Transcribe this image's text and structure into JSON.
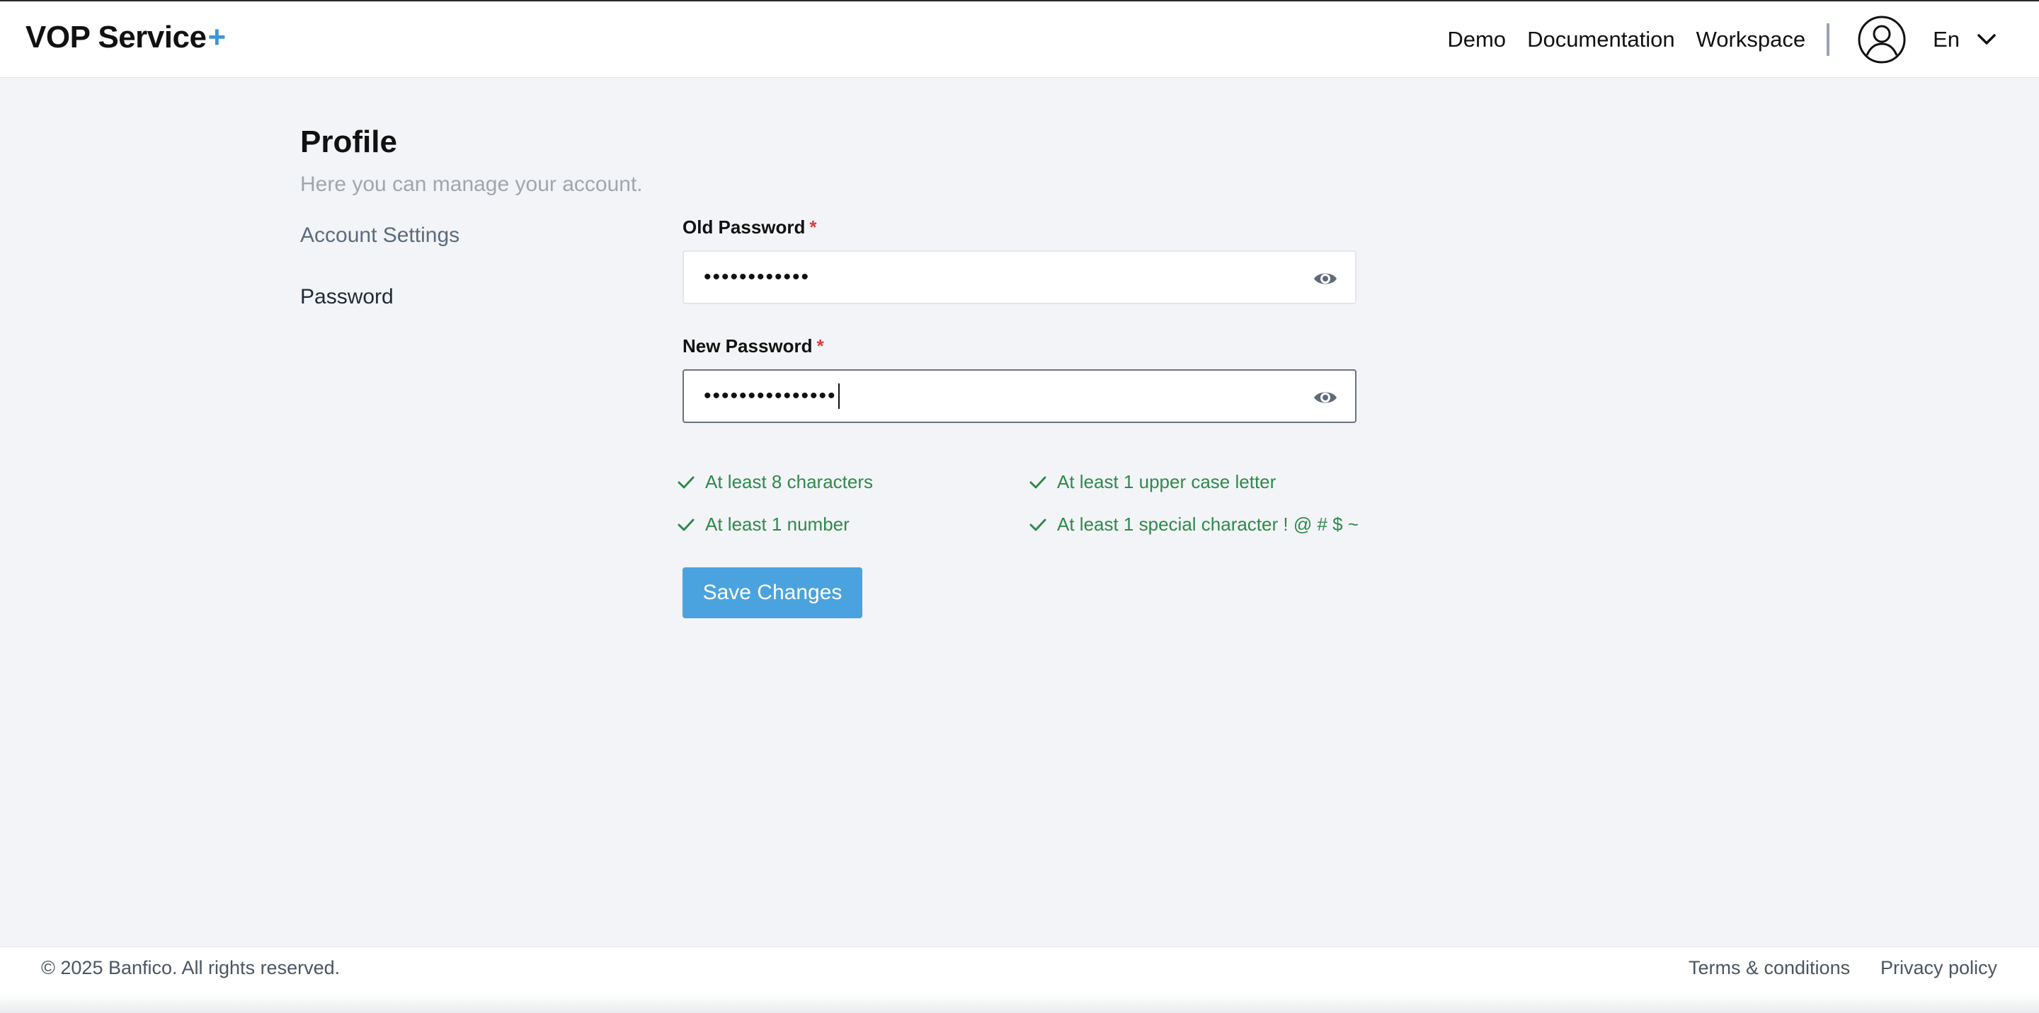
{
  "header": {
    "logo_text": "VOP Service",
    "logo_plus": "+",
    "nav": [
      "Demo",
      "Documentation",
      "Workspace"
    ],
    "language": "En",
    "accent_color": "#3b97d8"
  },
  "profile": {
    "title": "Profile",
    "subtitle": "Here you can manage your account."
  },
  "sidebar": {
    "items": [
      {
        "label": "Account Settings"
      },
      {
        "label": "Password"
      }
    ]
  },
  "form": {
    "old_password": {
      "label": "Old Password",
      "required_mark": "*",
      "value": "••••••••••••"
    },
    "new_password": {
      "label": "New Password",
      "required_mark": "*",
      "value": "•••••••••••••••"
    },
    "rules": [
      "At least 8 characters",
      "At least 1 upper case letter",
      "At least 1 number",
      "At least 1 special character ! @ # $ ~"
    ],
    "save_label": "Save Changes"
  },
  "footer": {
    "copyright": "© 2025 Banfico. All rights reserved.",
    "terms": "Terms & conditions",
    "privacy": "Privacy policy"
  }
}
